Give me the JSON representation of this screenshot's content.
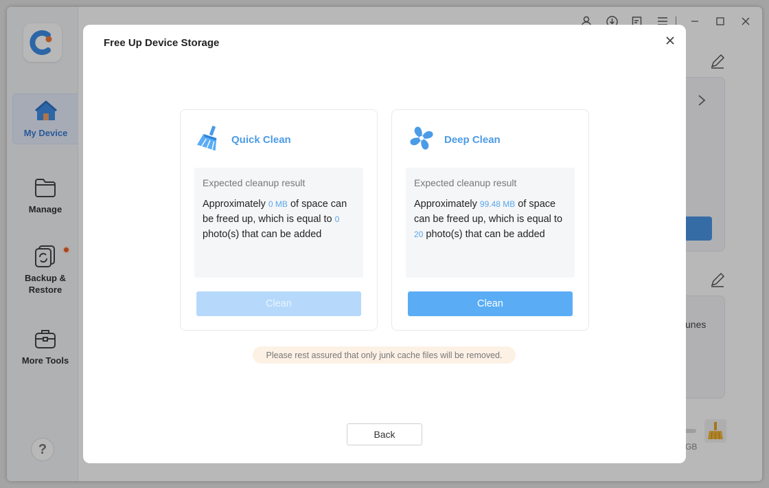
{
  "sidebar": {
    "items": [
      {
        "label": "My Device",
        "icon": "home-icon",
        "active": true
      },
      {
        "label": "Manage",
        "icon": "folder-icon"
      },
      {
        "label": "Backup & Restore",
        "icon": "backup-restore-icon",
        "badge": true
      },
      {
        "label": "More Tools",
        "icon": "toolbox-icon"
      }
    ],
    "help_label": "?"
  },
  "titlebar": {
    "icons": [
      "user-icon",
      "download-icon",
      "feedback-icon",
      "menu-icon",
      "minimize-icon",
      "maximize-icon",
      "close-icon"
    ]
  },
  "background": {
    "partial_text_itunes": "unes",
    "partial_text_gb": "GB"
  },
  "dialog": {
    "title": "Free Up Device Storage",
    "quick": {
      "title": "Quick Clean",
      "result_label": "Expected cleanup result",
      "text_1": "Approximately ",
      "size": "0 MB",
      "text_2": " of space can be freed up, which is equal to ",
      "photos": "0",
      "text_3": " photo(s) that can be added",
      "button": "Clean",
      "enabled": false
    },
    "deep": {
      "title": "Deep Clean",
      "result_label": "Expected cleanup result",
      "text_1": "Approximately ",
      "size": "99.48 MB",
      "text_2": " of space can be freed up, which is equal to ",
      "photos": "20",
      "text_3": " photo(s) that can be added",
      "button": "Clean",
      "enabled": true
    },
    "notice": "Please rest assured that only junk cache files will be removed.",
    "back_button": "Back"
  },
  "colors": {
    "accent": "#5aadf5",
    "accent_disabled": "#b6d9fb",
    "title_blue": "#4b9be6",
    "notice_bg": "#fdf1e6",
    "badge": "#e8622a"
  }
}
